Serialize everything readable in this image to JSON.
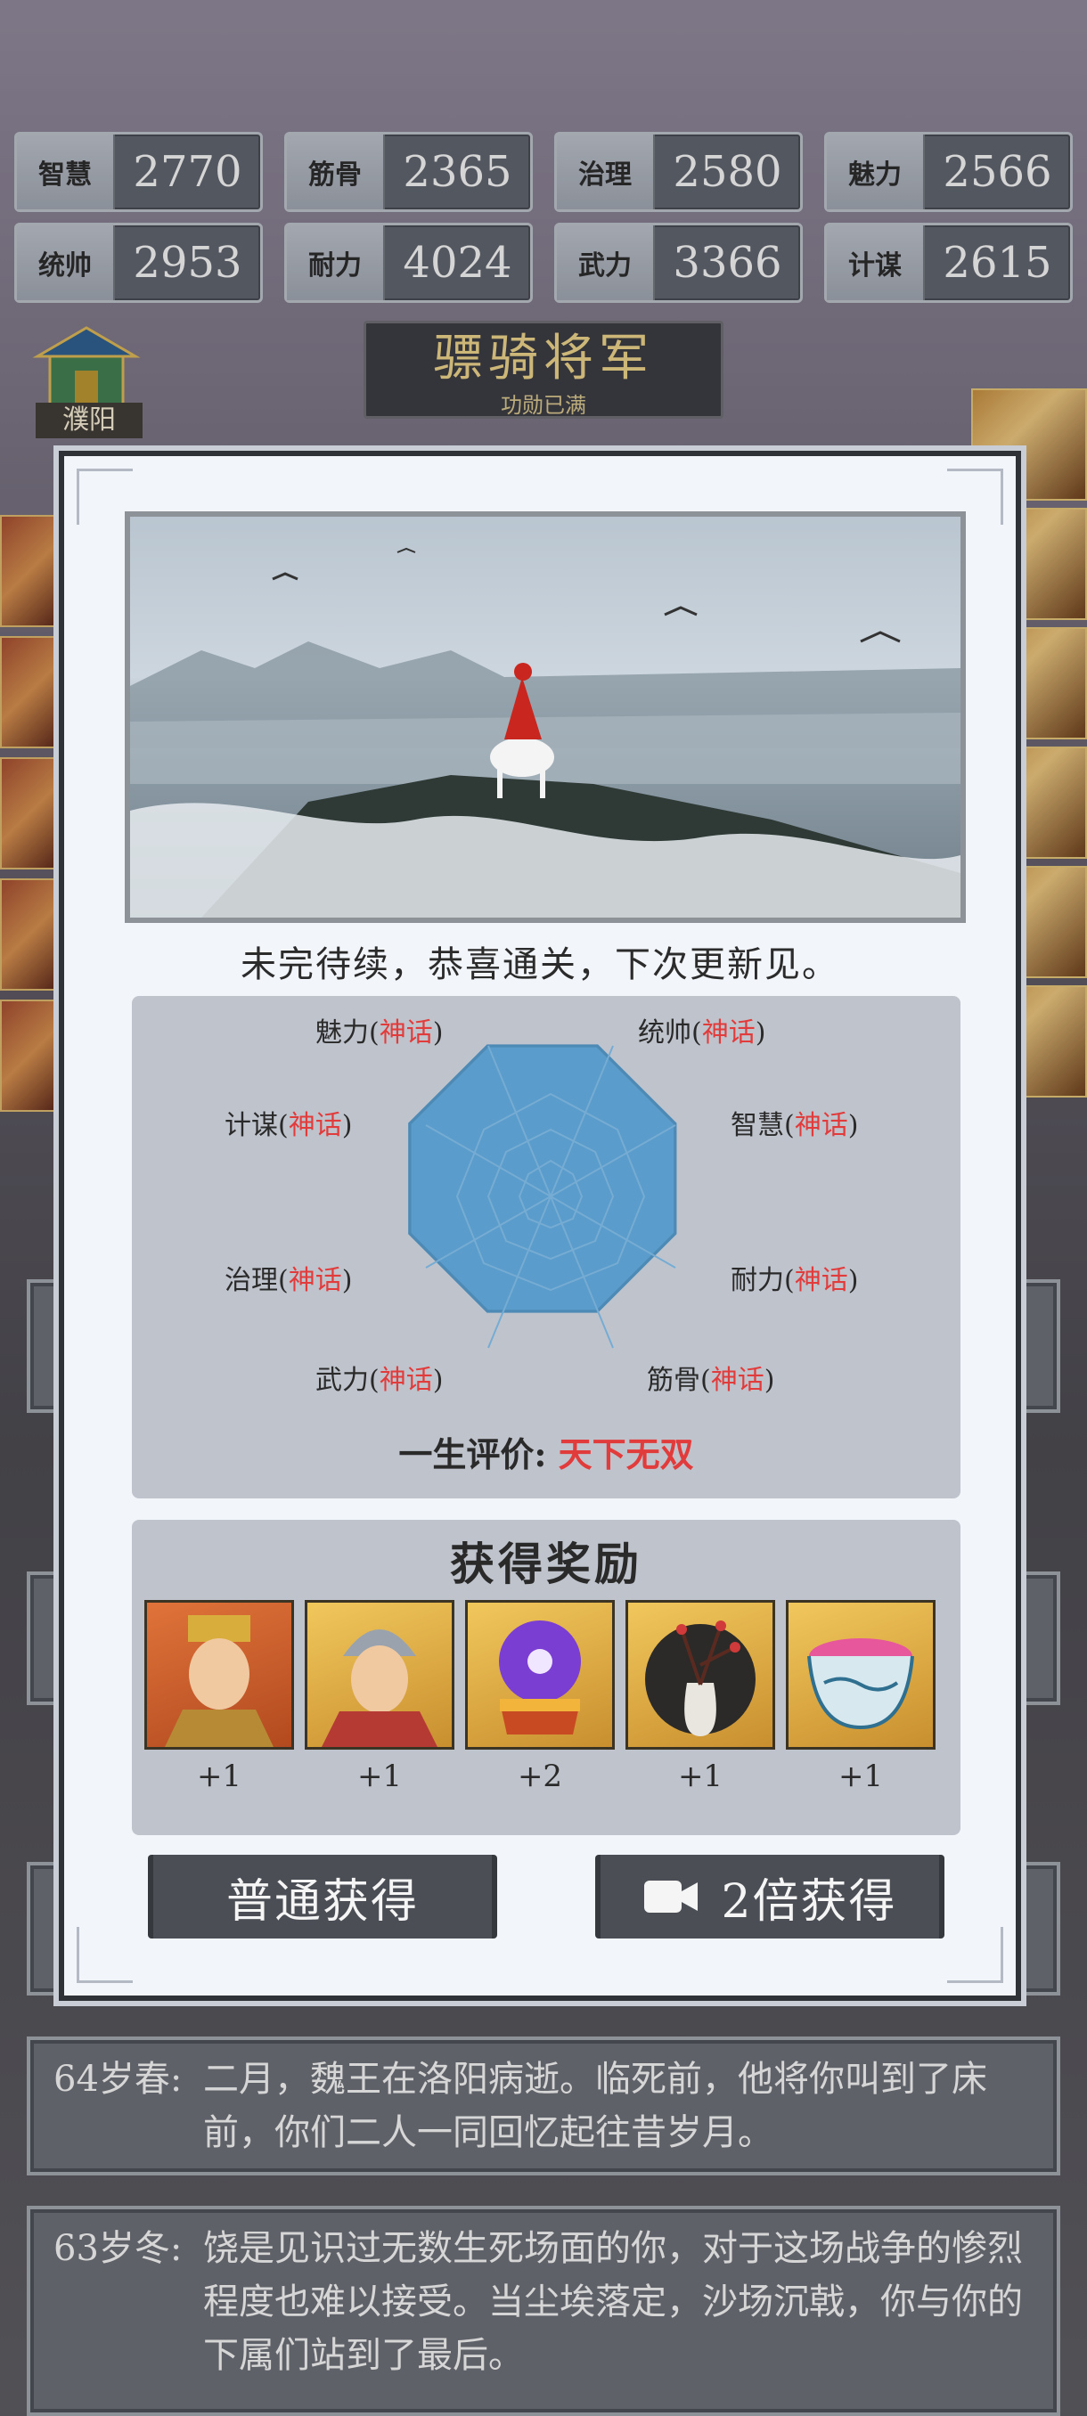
{
  "stats": [
    {
      "name": "智慧",
      "value": "2770"
    },
    {
      "name": "筋骨",
      "value": "2365"
    },
    {
      "name": "治理",
      "value": "2580"
    },
    {
      "name": "魅力",
      "value": "2566"
    },
    {
      "name": "统帅",
      "value": "2953"
    },
    {
      "name": "耐力",
      "value": "4024"
    },
    {
      "name": "武力",
      "value": "3366"
    },
    {
      "name": "计谋",
      "value": "2615"
    }
  ],
  "rank": {
    "title": "骠骑将军",
    "subtitle": "功勋已满"
  },
  "city": {
    "name": "濮阳"
  },
  "log": [
    {
      "age": "64岁春:",
      "text": "二月，魏王在洛阳病逝。临死前，他将你叫到了床前，你们二人一同回忆起往昔岁月。"
    },
    {
      "age": "63岁冬:",
      "text": "饶是见识过无数生死场面的你，对于这场战争的惨烈程度也难以接受。当尘埃落定，沙场沉戟，你与你的下属们站到了最后。"
    }
  ],
  "modal": {
    "ending_text": "未完待续，恭喜通关，下次更新见。",
    "radar": {
      "labels": [
        {
          "name": "魅力",
          "tier": "神话"
        },
        {
          "name": "统帅",
          "tier": "神话"
        },
        {
          "name": "计谋",
          "tier": "神话"
        },
        {
          "name": "智慧",
          "tier": "神话"
        },
        {
          "name": "治理",
          "tier": "神话"
        },
        {
          "name": "耐力",
          "tier": "神话"
        },
        {
          "name": "武力",
          "tier": "神话"
        },
        {
          "name": "筋骨",
          "tier": "神话"
        }
      ],
      "life_eval_label": "一生评价:",
      "life_eval_value": "天下无双"
    },
    "rewards": {
      "title": "获得奖励",
      "items": [
        {
          "icon": "general-portrait-icon",
          "count": "+1"
        },
        {
          "icon": "warrior-portrait-icon",
          "count": "+1"
        },
        {
          "icon": "crystal-orb-icon",
          "count": "+2"
        },
        {
          "icon": "plum-vase-icon",
          "count": "+1"
        },
        {
          "icon": "porcelain-bowl-icon",
          "count": "+1"
        }
      ]
    },
    "buttons": {
      "normal": "普通获得",
      "double": "2倍获得"
    }
  },
  "colors": {
    "tier": "#e23b3b",
    "radar_fill": "#5a9ccb"
  }
}
